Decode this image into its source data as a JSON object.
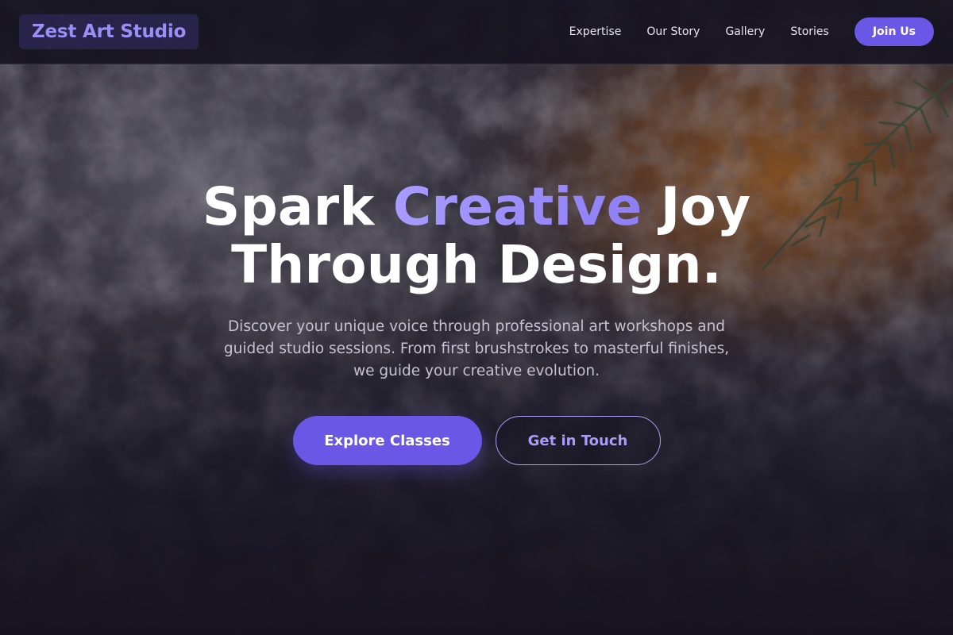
{
  "brand": {
    "name": "Zest Art Studio"
  },
  "nav": {
    "links": [
      "Expertise",
      "Our Story",
      "Gallery",
      "Stories"
    ],
    "cta_label": "Join Us"
  },
  "hero": {
    "headline_part1": "Spark ",
    "headline_accent": "Creative",
    "headline_part2": " Joy",
    "headline_line2": "Through Design.",
    "subtitle": "Discover your unique voice through professional art workshops and guided studio sessions. From first brushstrokes to masterful finishes, we guide your creative evolution.",
    "primary_cta": "Explore Classes",
    "secondary_cta": "Get in Touch"
  },
  "colors": {
    "accent": "#6b57e6",
    "accent_light": "#a99cf6",
    "background": "#15131f",
    "text": "#ffffff"
  },
  "background_image": "textured-paint-palette"
}
